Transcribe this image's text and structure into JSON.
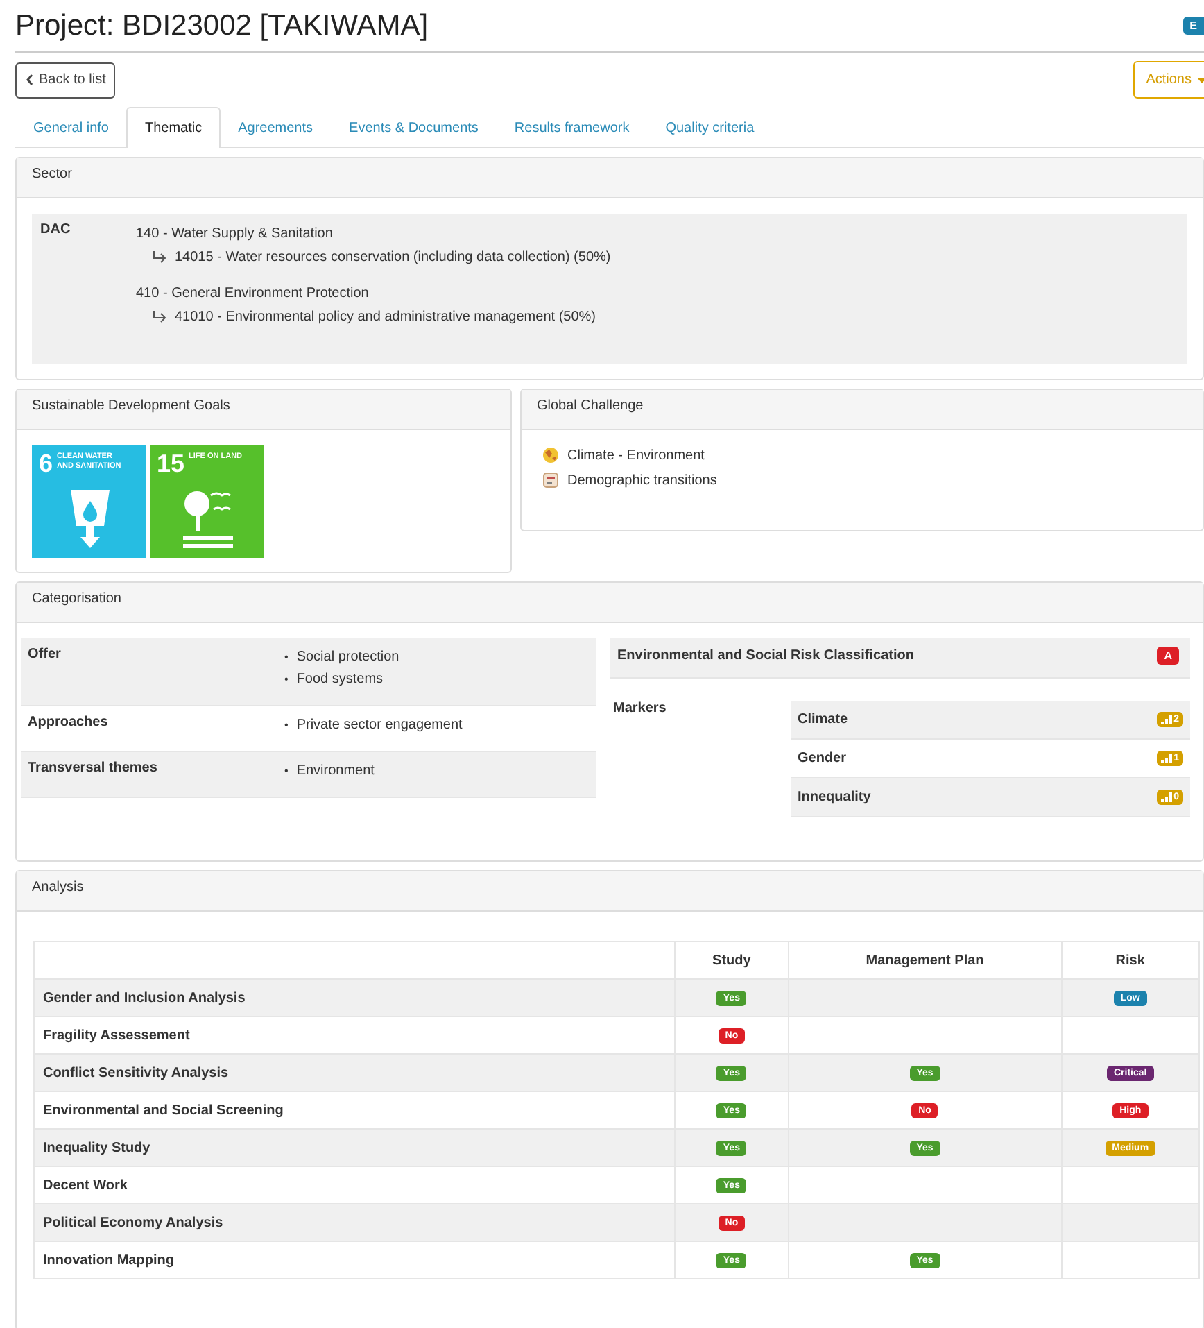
{
  "title": "Project: BDI23002 [TAKIWAMA]",
  "corner_badge": "E",
  "back_button": "Back to list",
  "actions_button": "Actions",
  "tabs": [
    {
      "label": "General info",
      "selected": false
    },
    {
      "label": "Thematic",
      "selected": true
    },
    {
      "label": "Agreements",
      "selected": false
    },
    {
      "label": "Events & Documents",
      "selected": false
    },
    {
      "label": "Results framework",
      "selected": false
    },
    {
      "label": "Quality criteria",
      "selected": false
    }
  ],
  "sector": {
    "heading": "Sector",
    "label": "DAC",
    "items": [
      {
        "text": "140 - Water Supply & Sanitation",
        "children": [
          {
            "text": "14015 - Water resources conservation (including data collection) (50%)"
          }
        ]
      },
      {
        "text": "410 - General Environment Protection",
        "children": [
          {
            "text": "41010 - Environmental policy and administrative management (50%)"
          }
        ]
      }
    ]
  },
  "sdg": {
    "heading": "Sustainable Development Goals",
    "goals": [
      {
        "number": "6",
        "label": "CLEAN WATER AND SANITATION",
        "color": "#26bde2",
        "kind": "water"
      },
      {
        "number": "15",
        "label": "LIFE ON LAND",
        "color": "#56c02b",
        "kind": "land"
      }
    ]
  },
  "global_challenge": {
    "heading": "Global Challenge",
    "items": [
      {
        "text": "Climate - Environment",
        "kind": "climate"
      },
      {
        "text": "Demographic transitions",
        "kind": "demographic"
      }
    ]
  },
  "categorisation": {
    "heading": "Categorisation",
    "rows": [
      {
        "label": "Offer",
        "values": [
          "Social protection",
          "Food systems"
        ]
      },
      {
        "label": "Approaches",
        "values": [
          "Private sector engagement"
        ]
      },
      {
        "label": "Transversal themes",
        "values": [
          "Environment"
        ]
      }
    ],
    "risk_classification": {
      "label": "Environmental and Social Risk Classification",
      "badge": "A",
      "color": "#dd1f26"
    },
    "bullet": "•",
    "markers_label": "Markers",
    "markers": [
      {
        "name": "Climate",
        "score": "2"
      },
      {
        "name": "Gender",
        "score": "1"
      },
      {
        "name": "Innequality",
        "score": "0"
      }
    ]
  },
  "analysis": {
    "heading": "Analysis",
    "columns": [
      "Study",
      "Management Plan",
      "Risk"
    ],
    "rows": [
      {
        "name": "Gender and Inclusion Analysis",
        "cells": [
          {
            "text": "Yes",
            "color": "#4a9c2d"
          },
          null,
          {
            "text": "Low",
            "color": "#1c82ad"
          }
        ]
      },
      {
        "name": "Fragility Assessement",
        "cells": [
          {
            "text": "No",
            "color": "#dd1f26"
          },
          null,
          null
        ]
      },
      {
        "name": "Conflict Sensitivity Analysis",
        "cells": [
          {
            "text": "Yes",
            "color": "#4a9c2d"
          },
          {
            "text": "Yes",
            "color": "#4a9c2d"
          },
          {
            "text": "Critical",
            "color": "#6b2770"
          }
        ]
      },
      {
        "name": "Environmental and Social Screening",
        "cells": [
          {
            "text": "Yes",
            "color": "#4a9c2d"
          },
          {
            "text": "No",
            "color": "#dd1f26"
          },
          {
            "text": "High",
            "color": "#dd1f26"
          }
        ]
      },
      {
        "name": "Inequality Study",
        "cells": [
          {
            "text": "Yes",
            "color": "#4a9c2d"
          },
          {
            "text": "Yes",
            "color": "#4a9c2d"
          },
          {
            "text": "Medium",
            "color": "#d4a000"
          }
        ]
      },
      {
        "name": "Decent Work",
        "cells": [
          {
            "text": "Yes",
            "color": "#4a9c2d"
          },
          null,
          null
        ]
      },
      {
        "name": "Political Economy Analysis",
        "cells": [
          {
            "text": "No",
            "color": "#dd1f26"
          },
          null,
          null
        ]
      },
      {
        "name": "Innovation Mapping",
        "cells": [
          {
            "text": "Yes",
            "color": "#4a9c2d"
          },
          {
            "text": "Yes",
            "color": "#4a9c2d"
          },
          null
        ]
      }
    ]
  }
}
